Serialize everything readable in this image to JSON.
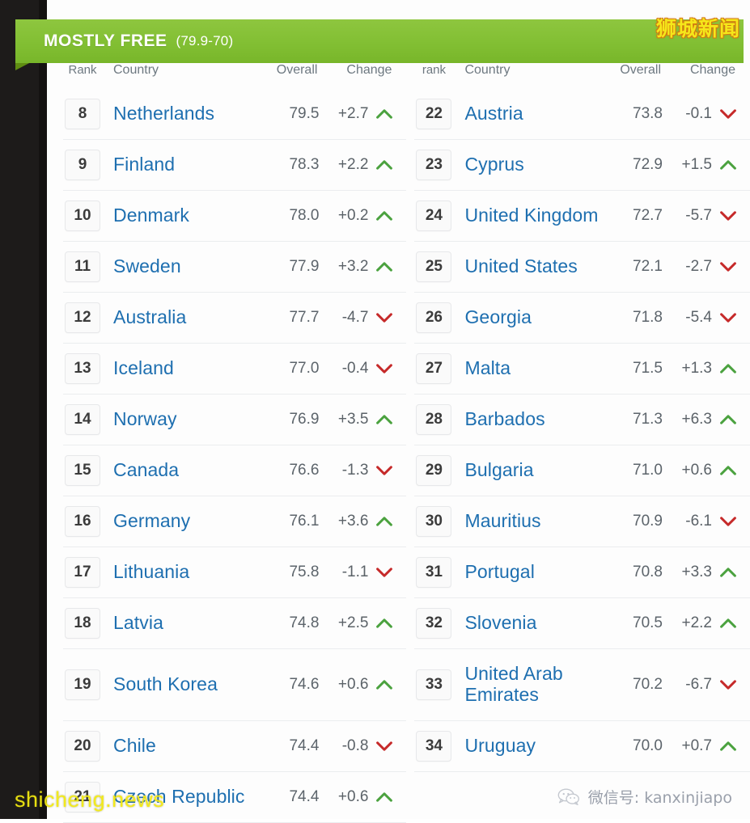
{
  "banner": {
    "label": "MOSTLY FREE",
    "range": "(79.9-70)",
    "color": "#8ec63f"
  },
  "watermarks": {
    "top_right": "狮城新闻",
    "bottom_left": "shicheng.news",
    "wechat_label": "微信号: kanxinjiapo",
    "wechat_icon": "wechat-icon"
  },
  "colors": {
    "country_link": "#1e6fb0",
    "up_arrow": "#4ba23f",
    "down_arrow": "#c62a2a",
    "header_text": "#6d7880"
  },
  "left_table": {
    "headers": {
      "rank": "Rank",
      "country": "Country",
      "overall": "Overall",
      "change": "Change"
    },
    "rows": [
      {
        "rank": "8",
        "country": "Netherlands",
        "overall": "79.5",
        "change": "+2.7",
        "dir": "up"
      },
      {
        "rank": "9",
        "country": "Finland",
        "overall": "78.3",
        "change": "+2.2",
        "dir": "up"
      },
      {
        "rank": "10",
        "country": "Denmark",
        "overall": "78.0",
        "change": "+0.2",
        "dir": "up"
      },
      {
        "rank": "11",
        "country": "Sweden",
        "overall": "77.9",
        "change": "+3.2",
        "dir": "up"
      },
      {
        "rank": "12",
        "country": "Australia",
        "overall": "77.7",
        "change": "-4.7",
        "dir": "down"
      },
      {
        "rank": "13",
        "country": "Iceland",
        "overall": "77.0",
        "change": "-0.4",
        "dir": "down"
      },
      {
        "rank": "14",
        "country": "Norway",
        "overall": "76.9",
        "change": "+3.5",
        "dir": "up"
      },
      {
        "rank": "15",
        "country": "Canada",
        "overall": "76.6",
        "change": "-1.3",
        "dir": "down"
      },
      {
        "rank": "16",
        "country": "Germany",
        "overall": "76.1",
        "change": "+3.6",
        "dir": "up"
      },
      {
        "rank": "17",
        "country": "Lithuania",
        "overall": "75.8",
        "change": "-1.1",
        "dir": "down"
      },
      {
        "rank": "18",
        "country": "Latvia",
        "overall": "74.8",
        "change": "+2.5",
        "dir": "up"
      },
      {
        "rank": "19",
        "country": "South Korea",
        "overall": "74.6",
        "change": "+0.6",
        "dir": "up",
        "tall": true
      },
      {
        "rank": "20",
        "country": "Chile",
        "overall": "74.4",
        "change": "-0.8",
        "dir": "down"
      },
      {
        "rank": "21",
        "country": "Czech Republic",
        "overall": "74.4",
        "change": "+0.6",
        "dir": "up"
      }
    ]
  },
  "right_table": {
    "headers": {
      "rank": "rank",
      "country": "Country",
      "overall": "Overall",
      "change": "Change"
    },
    "rows": [
      {
        "rank": "22",
        "country": "Austria",
        "overall": "73.8",
        "change": "-0.1",
        "dir": "down"
      },
      {
        "rank": "23",
        "country": "Cyprus",
        "overall": "72.9",
        "change": "+1.5",
        "dir": "up"
      },
      {
        "rank": "24",
        "country": "United Kingdom",
        "overall": "72.7",
        "change": "-5.7",
        "dir": "down"
      },
      {
        "rank": "25",
        "country": "United States",
        "overall": "72.1",
        "change": "-2.7",
        "dir": "down"
      },
      {
        "rank": "26",
        "country": "Georgia",
        "overall": "71.8",
        "change": "-5.4",
        "dir": "down"
      },
      {
        "rank": "27",
        "country": "Malta",
        "overall": "71.5",
        "change": "+1.3",
        "dir": "up"
      },
      {
        "rank": "28",
        "country": "Barbados",
        "overall": "71.3",
        "change": "+6.3",
        "dir": "up"
      },
      {
        "rank": "29",
        "country": "Bulgaria",
        "overall": "71.0",
        "change": "+0.6",
        "dir": "up"
      },
      {
        "rank": "30",
        "country": "Mauritius",
        "overall": "70.9",
        "change": "-6.1",
        "dir": "down"
      },
      {
        "rank": "31",
        "country": "Portugal",
        "overall": "70.8",
        "change": "+3.3",
        "dir": "up"
      },
      {
        "rank": "32",
        "country": "Slovenia",
        "overall": "70.5",
        "change": "+2.2",
        "dir": "up"
      },
      {
        "rank": "33",
        "country": "United Arab Emirates",
        "overall": "70.2",
        "change": "-6.7",
        "dir": "down",
        "tall": true
      },
      {
        "rank": "34",
        "country": "Uruguay",
        "overall": "70.0",
        "change": "+0.7",
        "dir": "up"
      }
    ]
  }
}
